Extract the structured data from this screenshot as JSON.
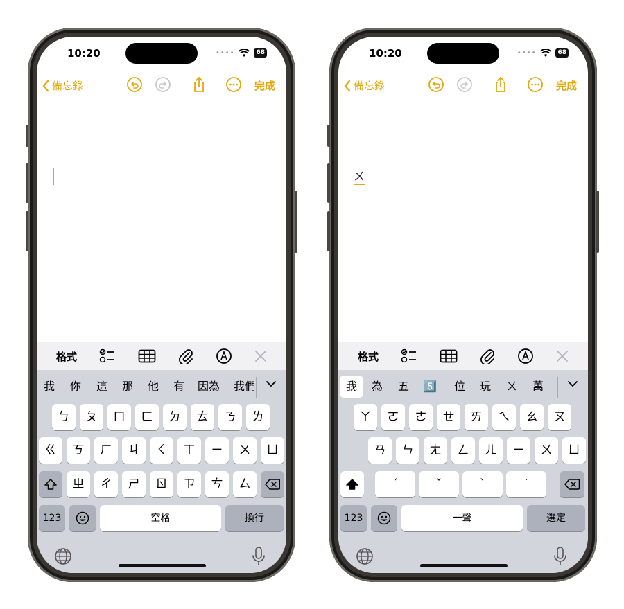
{
  "status": {
    "time": "10:20",
    "battery": "68"
  },
  "nav": {
    "back_label": "備忘錄",
    "done_label": "完成"
  },
  "toolbar": {
    "format_label": "格式"
  },
  "left": {
    "candidates": [
      "我",
      "你",
      "這",
      "那",
      "他",
      "有",
      "因為",
      "我們"
    ],
    "row1": [
      "ㄅ",
      "ㄆ",
      "ㄇ",
      "ㄈ",
      "ㄉ",
      "ㄊ",
      "ㄋ",
      "ㄌ"
    ],
    "row2": [
      "ㄍ",
      "ㄎ",
      "ㄏ",
      "ㄐ",
      "ㄑ",
      "ㄒ",
      "ㄧ",
      "ㄨ",
      "ㄩ"
    ],
    "row3": [
      "ㄓ",
      "ㄔ",
      "ㄕ",
      "ㄖ",
      "ㄗ",
      "ㄘ",
      "ㄙ"
    ],
    "num_label": "123",
    "space_label": "空格",
    "return_label": "換行"
  },
  "right": {
    "typed_text": "ㄨ",
    "candidates": [
      "我",
      "為",
      "五",
      "5️⃣",
      "位",
      "玩",
      "ㄨ",
      "萬"
    ],
    "row1": [
      "ㄚ",
      "ㄛ",
      "ㄜ",
      "ㄝ",
      "ㄞ",
      "ㄟ",
      "ㄠ",
      "ㄡ"
    ],
    "row2": [
      "ㄢ",
      "ㄣ",
      "ㄤ",
      "ㄥ",
      "ㄦ",
      "ㄧ",
      "ㄨ",
      "ㄩ"
    ],
    "tones": [
      "ˊ",
      "ˇ",
      "ˋ",
      "˙"
    ],
    "num_label": "123",
    "space_label": "一聲",
    "return_label": "選定"
  },
  "colors": {
    "accent": "#e3a80f",
    "keyboard_bg": "#d2d5dc",
    "dark_key": "#acb1bb"
  },
  "icons": [
    "undo-icon",
    "redo-icon",
    "share-icon",
    "more-icon",
    "checklist-icon",
    "table-icon",
    "paperclip-icon",
    "markup-icon",
    "close-icon",
    "shift-icon",
    "delete-icon",
    "emoji-icon",
    "globe-icon",
    "microphone-icon",
    "chevron-down-icon"
  ]
}
